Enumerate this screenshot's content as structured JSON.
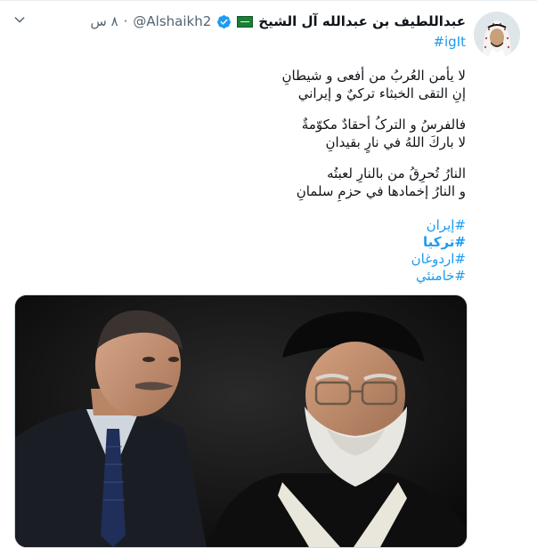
{
  "tweet": {
    "display_name": "عبداللطيف بن عبدالله آل الشيخ",
    "handle": "@Alshaikh2",
    "separator": "·",
    "time": "٨ س",
    "first_hashtag": "#igIt",
    "poem": [
      "لا يأمن العُربُ من أفعى و شيطانِ",
      "إنِ التقى الخبثاء تركيٌ و إيراني",
      "",
      "فالفرسُ و الترکُ أحقادٌ مكوّمةٌ",
      "لا باركَ اللهُ في نارٍ بقيدانِ",
      "",
      "النارُ تُحرِقُ من بالنارِ لعبتُه",
      "و النارُ إخمادها في حزمِ سلمانِ"
    ],
    "hashtags": [
      "#إيران",
      "#تركيا",
      "#اردوغان",
      "#خامنئي"
    ]
  },
  "icons": {
    "verified": "verified-badge-icon",
    "flag": "saudi-flag-icon",
    "caret": "chevron-down-icon"
  },
  "colors": {
    "link": "#1d9bf0",
    "text": "#0f1419",
    "muted": "#536471",
    "verified": "#1d9bf0"
  }
}
